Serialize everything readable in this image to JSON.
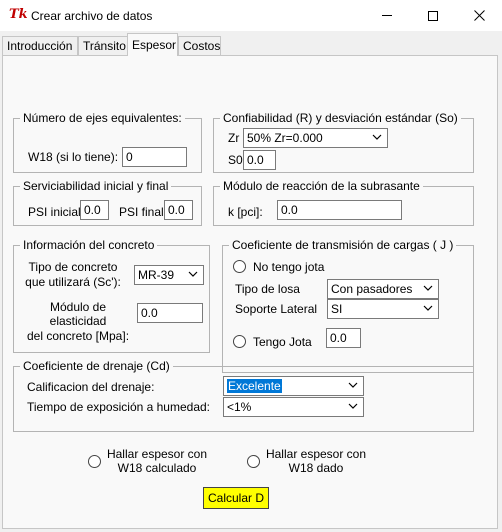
{
  "window": {
    "title": "Crear archivo de datos",
    "icon": "tk-feather-icon",
    "minimize": "minimize-icon",
    "maximize": "maximize-icon",
    "close": "close-icon"
  },
  "tabs": [
    {
      "label": "Introducción"
    },
    {
      "label": "Tránsito"
    },
    {
      "label": "Espesor",
      "active": true
    },
    {
      "label": "Costos"
    }
  ],
  "ejes": {
    "title": "Número de ejes equivalentes:",
    "w18_label": "W18 (si lo tiene):",
    "w18_value": "0"
  },
  "confiabilidad": {
    "title": "Confiabilidad (R) y desviación estándar (So)",
    "zr_label": "Zr",
    "zr_value": "50% Zr=0.000",
    "s0_label": "S0",
    "s0_value": "0.0"
  },
  "serviciabilidad": {
    "title": "Serviciabilidad inicial y final",
    "psi_inicial_label": "PSI inicial",
    "psi_inicial_value": "0.0",
    "psi_final_label": "PSI final",
    "psi_final_value": "0.0"
  },
  "modulo_reaccion": {
    "title": "Módulo de reacción de la subrasante",
    "k_label": "k [pci]:",
    "k_value": "0.0"
  },
  "concreto": {
    "title": "Información del concreto",
    "tipo_label_1": "Tipo de concreto",
    "tipo_label_2": "que utilizará (Sc'):",
    "tipo_value": "MR-39",
    "modulo_label_1": "Módulo de",
    "modulo_label_2": "elasticidad",
    "modulo_label_3": "del concreto [Mpa]:",
    "modulo_value": "0.0"
  },
  "transmision": {
    "title": "Coeficiente de transmisión de cargas ( J )",
    "no_jota_label": "No tengo jota",
    "tipo_losa_label": "Tipo de losa",
    "tipo_losa_value": "Con pasadores",
    "soporte_label": "Soporte Lateral",
    "soporte_value": "SI",
    "tengo_jota_label": "Tengo Jota",
    "jota_value": "0.0"
  },
  "drenaje": {
    "title": "Coeficiente de drenaje (Cd)",
    "calificacion_label": "Calificacion del drenaje:",
    "calificacion_value": "Excelente",
    "tiempo_label": "Tiempo de exposición a humedad:",
    "tiempo_value": "<1%"
  },
  "hallar": {
    "calculado_1": "Hallar espesor con",
    "calculado_2": "W18 calculado",
    "dado_1": "Hallar espesor con",
    "dado_2": "W18 dado"
  },
  "calcular_label": "Calcular D",
  "colors": {
    "calcular_bg": "#ffff00",
    "selection": "#0078d7"
  }
}
